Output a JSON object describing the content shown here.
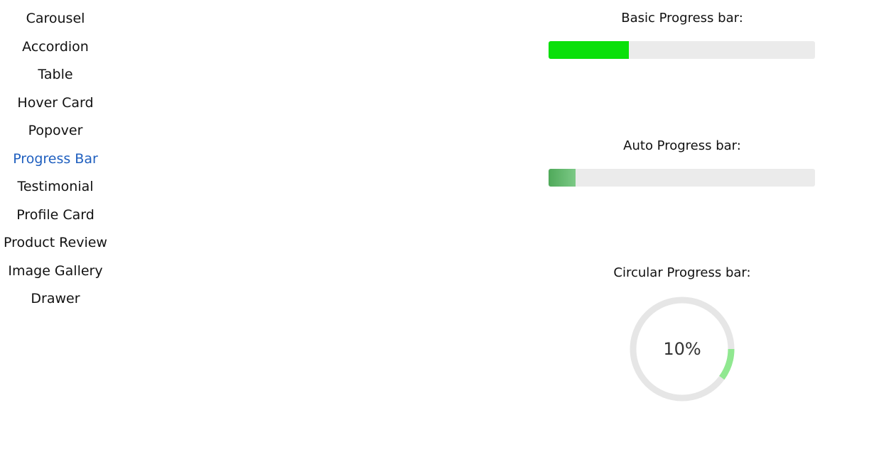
{
  "sidebar": {
    "items": [
      {
        "label": "Carousel"
      },
      {
        "label": "Accordion"
      },
      {
        "label": "Table"
      },
      {
        "label": "Hover Card"
      },
      {
        "label": "Popover"
      },
      {
        "label": "Progress Bar"
      },
      {
        "label": "Testimonial"
      },
      {
        "label": "Profile Card"
      },
      {
        "label": "Product Review"
      },
      {
        "label": "Image Gallery"
      },
      {
        "label": "Drawer"
      }
    ],
    "active_label": "Progress Bar",
    "active_color": "#1f5fbf"
  },
  "basic_progress": {
    "title": "Basic Progress bar:",
    "value_percent": 30,
    "fill_color": "#0ae00a"
  },
  "auto_progress": {
    "title": "Auto Progress bar:",
    "value_percent": 10,
    "fill_color": "#5cb56a"
  },
  "circular_progress": {
    "title": "Circular Progress bar:",
    "value_percent": 10,
    "label": "10%",
    "fill_color": "#90e890",
    "track_color": "#e6e6e6"
  }
}
